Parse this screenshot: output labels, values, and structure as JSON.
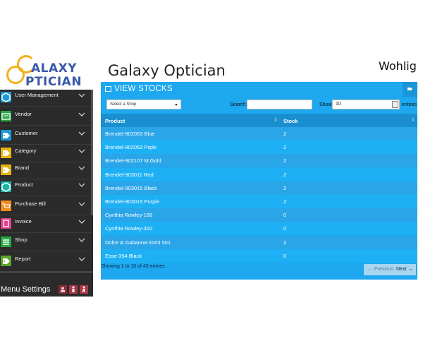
{
  "logo": {
    "line1": "ALAXY",
    "line2": "PTICIAN",
    "lettering": "Galaxy Optician"
  },
  "header": {
    "title": "Galaxy Optician",
    "welcome": "Wohlig"
  },
  "sidebar": {
    "items": [
      {
        "label": "User Management",
        "icon": "user-cube-icon",
        "color": "#1a9ad6"
      },
      {
        "label": "Vendor",
        "icon": "vendor-card-icon",
        "color": "#27a844"
      },
      {
        "label": "Customer",
        "icon": "tag-icon",
        "color": "#1a9ad6"
      },
      {
        "label": "Category",
        "icon": "tag-icon",
        "color": "#e8b30e"
      },
      {
        "label": "Brand",
        "icon": "tag-icon",
        "color": "#e8b30e"
      },
      {
        "label": "Product",
        "icon": "cube-icon",
        "color": "#19b5a5"
      },
      {
        "label": "Purchase Bill",
        "icon": "cart-icon",
        "color": "#f28c1a"
      },
      {
        "label": "Invoice",
        "icon": "document-icon",
        "color": "#e0428c"
      },
      {
        "label": "Shop",
        "icon": "list-icon",
        "color": "#27a844"
      },
      {
        "label": "Report",
        "icon": "tag-icon",
        "color": "#5aa52a"
      }
    ],
    "menu_settings": "Menu Settings"
  },
  "panel": {
    "title": "VIEW STOCKS",
    "shop_select": "Select a Shop",
    "search_label": "Search:",
    "search_value": "",
    "show_label": "Show",
    "show_value": "10",
    "entries_label": "entries",
    "columns": [
      "Product",
      "Stock"
    ],
    "rows": [
      {
        "product": "Brendel-902053 Blue",
        "stock": "2"
      },
      {
        "product": "Brendel-902053 Prple",
        "stock": "2"
      },
      {
        "product": "Brendel-902107 M.Gold",
        "stock": "2"
      },
      {
        "product": "Brendel-903011 Red",
        "stock": "2"
      },
      {
        "product": "Brendel-903015 Black",
        "stock": "2"
      },
      {
        "product": "Brendel-903015 Purple",
        "stock": "2"
      },
      {
        "product": "Cynthia Rowley-168",
        "stock": "0"
      },
      {
        "product": "Cynthia Rowley-310",
        "stock": "0"
      },
      {
        "product": "Dolce & Gabanna-3163 501",
        "stock": "2"
      },
      {
        "product": "Esse-354 Black",
        "stock": "0"
      }
    ],
    "info": "Showing 1 to 10 of 49 entries",
    "prev": "← Previous",
    "next": "Next →"
  },
  "colors": {
    "accent": "#1da8f0",
    "header_row": "#1a8fd0",
    "sidebar_bg": "#2b2b2b",
    "logo_blue": "#3b5aa8",
    "logo_gold": "#f2b01e"
  }
}
